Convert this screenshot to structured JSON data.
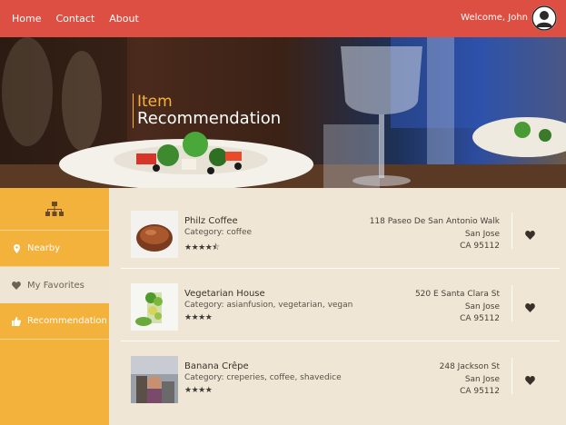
{
  "nav": {
    "links": [
      "Home",
      "Contact",
      "About"
    ],
    "welcome": "Welcome, John"
  },
  "hero": {
    "title_line1": "Item",
    "title_line2": "Recommendation"
  },
  "sidebar": {
    "items": [
      {
        "label": "Nearby",
        "icon": "map-marker-icon"
      },
      {
        "label": "My Favorites",
        "icon": "heart-icon"
      },
      {
        "label": "Recommendation",
        "icon": "thumbs-up-icon"
      }
    ],
    "active": "My Favorites"
  },
  "items": [
    {
      "name": "Philz Coffee",
      "category": "Category: coffee",
      "rating": 4.5,
      "address": {
        "line1": "118 Paseo De San Antonio Walk",
        "line2": "San Jose",
        "line3": "CA 95112"
      }
    },
    {
      "name": "Vegetarian House",
      "category": "Category: asianfusion, vegetarian, vegan",
      "rating": 4,
      "address": {
        "line1": "520 E Santa Clara St",
        "line2": "San Jose",
        "line3": "CA 95112"
      }
    },
    {
      "name": "Banana Crêpe",
      "category": "Category: creperies, coffee, shavedice",
      "rating": 4,
      "address": {
        "line1": "248 Jackson St",
        "line2": "San Jose",
        "line3": "CA 95112"
      }
    }
  ],
  "colors": {
    "nav_bg": "#de4f43",
    "sidebar_bg": "#f2b23c",
    "content_bg": "#f0e6d6",
    "accent": "#f7b23b"
  }
}
